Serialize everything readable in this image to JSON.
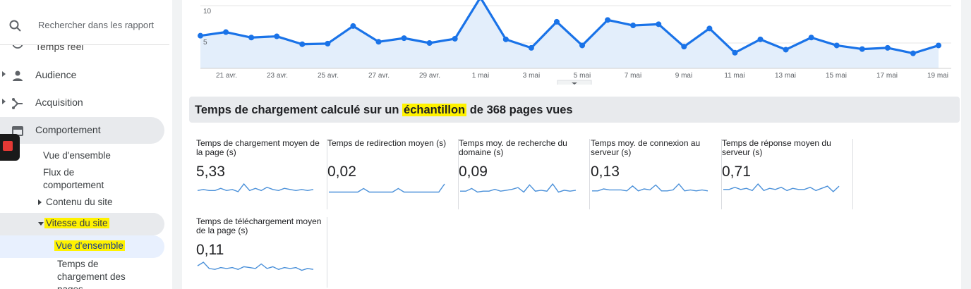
{
  "sidebar": {
    "search_placeholder": "Rechercher dans les rapport",
    "realtime_label": "Temps réel",
    "items": [
      {
        "label": "Audience"
      },
      {
        "label": "Acquisition"
      },
      {
        "label": "Comportement"
      }
    ],
    "behavior_sub": {
      "overview": "Vue d'ensemble",
      "flow_line1": "Flux de",
      "flow_line2": "comportement",
      "site_content": "Contenu du site",
      "site_speed": "Vitesse du site",
      "speed_overview": "Vue d'ensemble",
      "page_timings_line1": "Temps de",
      "page_timings_line2": "chargement des",
      "page_timings_line3": "pages"
    }
  },
  "chart_data": {
    "type": "area",
    "x_tick_labels": [
      "21 avr.",
      "23 avr.",
      "25 avr.",
      "27 avr.",
      "29 avr.",
      "1 mai",
      "3 mai",
      "5 mai",
      "7 mai",
      "9 mai",
      "11 mai",
      "13 mai",
      "15 mai",
      "17 mai",
      "19 mai"
    ],
    "y_tick_labels": [
      "10",
      "5"
    ],
    "values": [
      6.2,
      6.8,
      5.9,
      6.1,
      4.8,
      4.9,
      7.8,
      5.2,
      5.8,
      5.0,
      5.7,
      12.5,
      5.6,
      4.2,
      8.5,
      4.6,
      8.8,
      7.9,
      8.1,
      4.4,
      7.4,
      3.4,
      5.6,
      3.9,
      5.9,
      4.6,
      4.0,
      4.2,
      3.3,
      4.6
    ],
    "color": "#1a73e8",
    "fill": "#e3eefb"
  },
  "section": {
    "title_before": "Temps de chargement calculé sur un ",
    "title_highlight": "échantillon",
    "title_after": " de 368 pages vues"
  },
  "metrics": [
    {
      "label": "Temps de chargement moyen de la page (s)",
      "value": "5,33",
      "spark": [
        3,
        4,
        3,
        3,
        5,
        3,
        4,
        2,
        9,
        3,
        5,
        3,
        6,
        4,
        3,
        5,
        4,
        3,
        4,
        3,
        4
      ]
    },
    {
      "label": "Temps de redirection moyen (s)",
      "value": "0,02",
      "spark": [
        2,
        2,
        2,
        2,
        2,
        2,
        6,
        2,
        2,
        2,
        2,
        2,
        6,
        2,
        2,
        2,
        2,
        2,
        2,
        2,
        11
      ]
    },
    {
      "label": "Temps moy. de recherche du domaine (s)",
      "value": "0,09",
      "spark": [
        3,
        3,
        6,
        2,
        3,
        3,
        5,
        3,
        4,
        5,
        7,
        2,
        10,
        3,
        4,
        3,
        11,
        2,
        4,
        3,
        4
      ]
    },
    {
      "label": "Temps moy. de connexion au serveur (s)",
      "value": "0,13",
      "spark": [
        3,
        3,
        5,
        4,
        4,
        4,
        3,
        8,
        3,
        5,
        4,
        9,
        3,
        3,
        4,
        10,
        3,
        4,
        3,
        4,
        3
      ]
    },
    {
      "label": "Temps de réponse moyen du serveur (s)",
      "value": "0,71",
      "spark": [
        4,
        4,
        6,
        4,
        5,
        3,
        9,
        3,
        5,
        4,
        6,
        3,
        5,
        4,
        4,
        6,
        3,
        5,
        7,
        2,
        7
      ]
    },
    {
      "label": "Temps de téléchargement moyen de la page (s)",
      "value": "0,11",
      "spark": [
        7,
        11,
        4,
        3,
        5,
        4,
        5,
        3,
        6,
        5,
        4,
        9,
        4,
        6,
        3,
        5,
        4,
        5,
        2,
        4,
        3
      ]
    }
  ]
}
